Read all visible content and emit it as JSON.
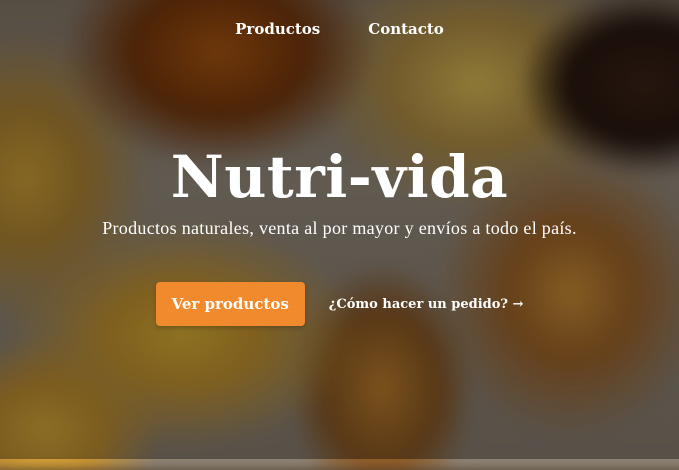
{
  "nav": {
    "items": [
      "Productos",
      "Contacto"
    ]
  },
  "hero": {
    "title": "Nutri-vida",
    "subtitle": "Productos naturales, venta al por mayor y envíos a todo el país.",
    "primary_button": "Ver productos",
    "secondary_link": "¿Cómo hacer un pedido? →"
  },
  "colors": {
    "accent": "#f08a2c",
    "text": "#ffffff"
  }
}
